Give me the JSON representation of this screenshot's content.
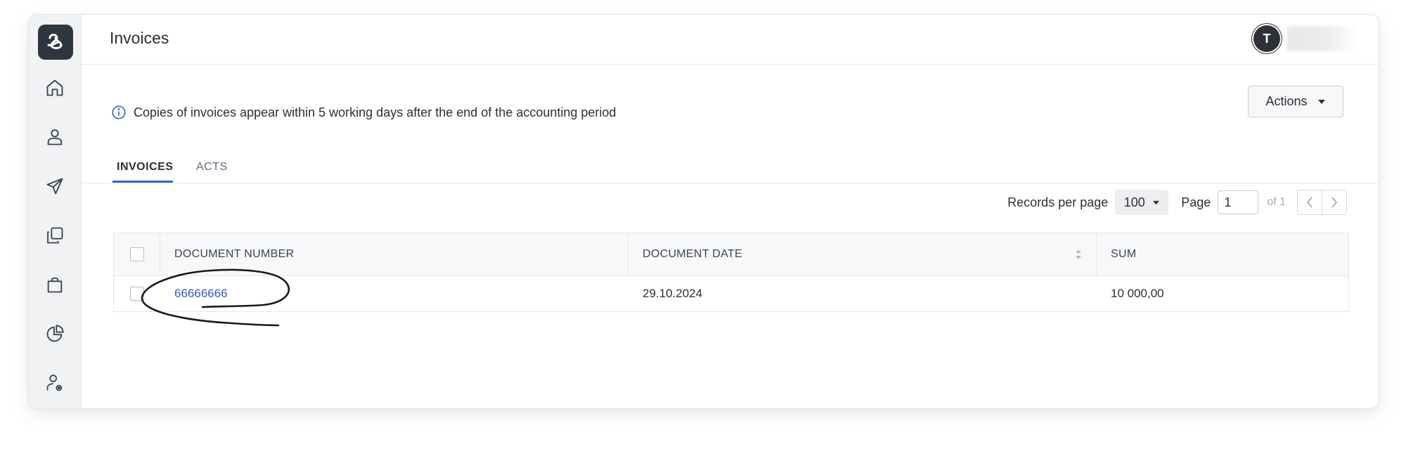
{
  "header": {
    "title": "Invoices",
    "avatar_initial": "T"
  },
  "notice": {
    "text": "Copies of invoices appear within 5 working days after the end of the accounting period"
  },
  "actions": {
    "label": "Actions"
  },
  "tabs": [
    {
      "label": "INVOICES",
      "active": true
    },
    {
      "label": "ACTS",
      "active": false
    }
  ],
  "pagination": {
    "records_per_page_label": "Records per page",
    "records_per_page_value": "100",
    "page_label": "Page",
    "page_value": "1",
    "of_label": "of 1"
  },
  "table": {
    "columns": [
      "DOCUMENT NUMBER",
      "DOCUMENT DATE",
      "SUM"
    ],
    "rows": [
      {
        "number": "66666666",
        "date": "29.10.2024",
        "sum": "10 000,00"
      }
    ]
  },
  "sidebar": {
    "items": [
      "home-icon",
      "user-icon",
      "send-icon",
      "copy-icon",
      "shopping-bag-icon",
      "pie-chart-icon",
      "user-settings-icon"
    ]
  },
  "colors": {
    "accent": "#2e64d8",
    "link": "#2e5bc4",
    "sidebar_bg": "#f1f2f4",
    "logo_bg": "#2e3640"
  }
}
